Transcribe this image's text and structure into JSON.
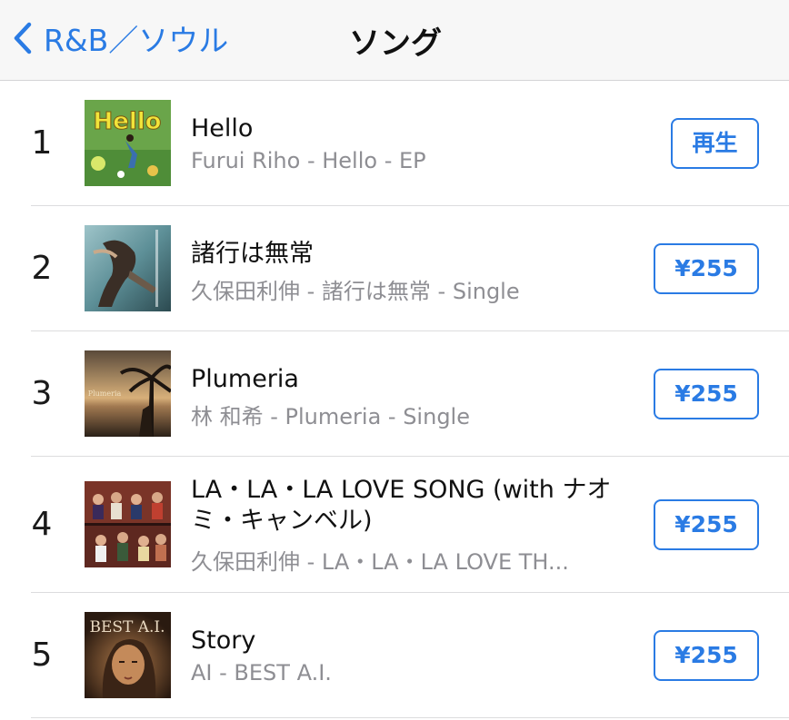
{
  "navbar": {
    "back_label": "R&B／ソウル",
    "title": "ソング"
  },
  "colors": {
    "accent": "#2a7be4",
    "secondary_text": "#8e8e93",
    "navbar_bg": "#f7f7f7"
  },
  "songs": [
    {
      "rank": "1",
      "title": "Hello",
      "subtitle": "Furui Riho - Hello - EP",
      "action": "再生",
      "artwork_text": "Hello"
    },
    {
      "rank": "2",
      "title": "諸行は無常",
      "subtitle": "久保田利伸 - 諸行は無常 - Single",
      "action": "¥255",
      "artwork_text": ""
    },
    {
      "rank": "3",
      "title": "Plumeria",
      "subtitle": "林 和希 - Plumeria - Single",
      "action": "¥255",
      "artwork_text": "Plumeria"
    },
    {
      "rank": "4",
      "title": "LA・LA・LA LOVE SONG (with ナオミ・キャンベル)",
      "subtitle": "久保田利伸 - LA・LA・LA LOVE TH...",
      "action": "¥255",
      "artwork_text": ""
    },
    {
      "rank": "5",
      "title": "Story",
      "subtitle": "AI - BEST A.I.",
      "action": "¥255",
      "artwork_text": "BEST A.I."
    }
  ]
}
